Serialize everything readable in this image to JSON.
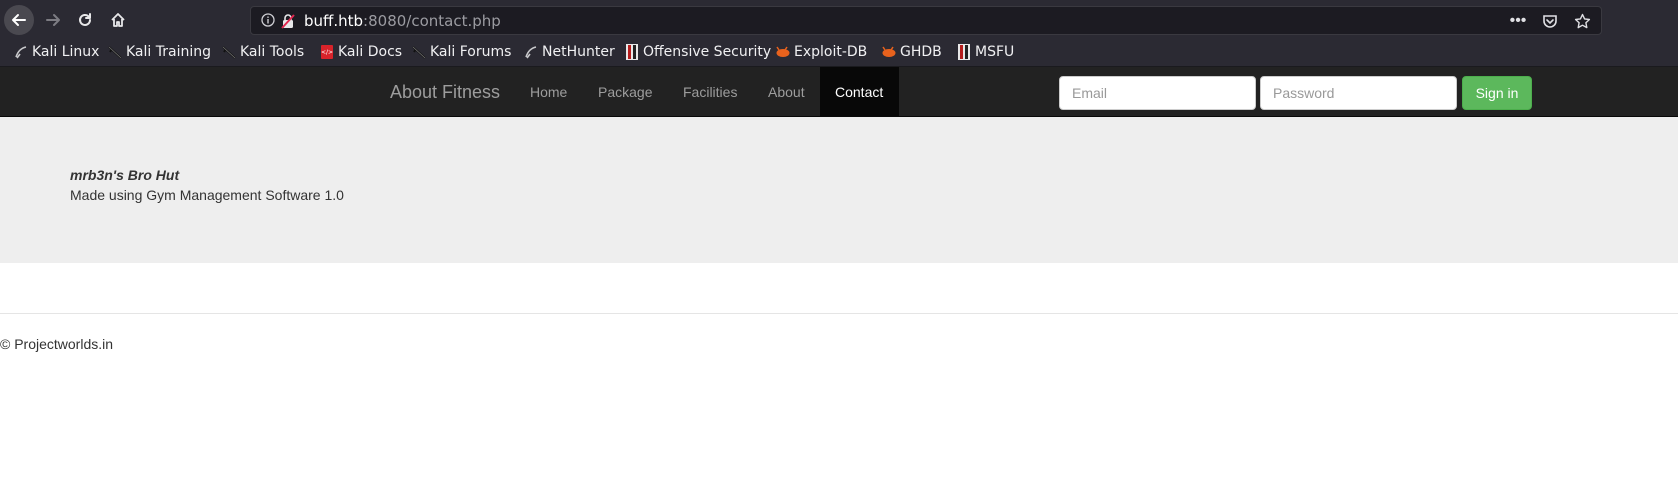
{
  "browser": {
    "url_host": "buff.htb",
    "url_rest": ":8080/contact.php"
  },
  "bookmarks": [
    {
      "label": "Kali Linux",
      "icon": "kali-dragon-icon"
    },
    {
      "label": "Kali Training",
      "icon": "kali-dragon-icon"
    },
    {
      "label": "Kali Tools",
      "icon": "kali-dragon-icon"
    },
    {
      "label": "Kali Docs",
      "icon": "kali-docs-icon"
    },
    {
      "label": "Kali Forums",
      "icon": "kali-dragon-icon"
    },
    {
      "label": "NetHunter",
      "icon": "kali-dragon-icon"
    },
    {
      "label": "Offensive Security",
      "icon": "offsec-icon"
    },
    {
      "label": "Exploit-DB",
      "icon": "exploitdb-icon"
    },
    {
      "label": "GHDB",
      "icon": "exploitdb-icon"
    },
    {
      "label": "MSFU",
      "icon": "offsec-icon"
    }
  ],
  "navbar": {
    "brand": "About Fitness",
    "links": [
      "Home",
      "Package",
      "Facilities",
      "About",
      "Contact"
    ],
    "active": "Contact",
    "email_placeholder": "Email",
    "password_placeholder": "Password",
    "signin_label": "Sign in"
  },
  "main": {
    "title": "mrb3n's Bro Hut",
    "subtitle": "Made using Gym Management Software 1.0"
  },
  "footer": {
    "text": "© Projectworlds.in"
  },
  "colors": {
    "navbar_bg": "#222222",
    "active_bg": "#080808",
    "signin_bg": "#5cb85c",
    "jumbotron_bg": "#eeeeee"
  }
}
